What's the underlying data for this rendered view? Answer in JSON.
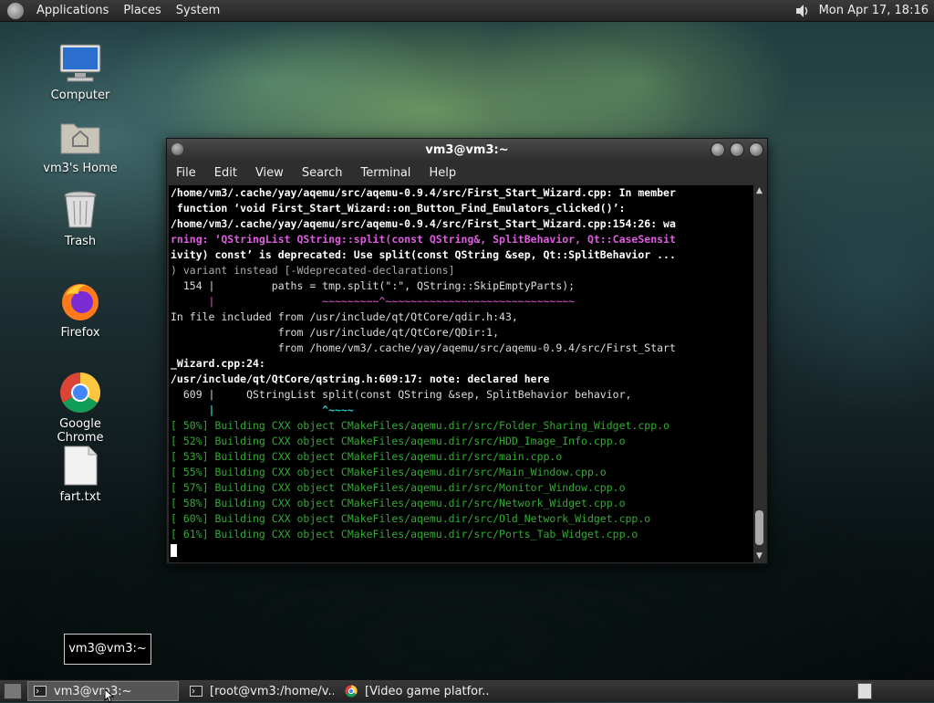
{
  "top_panel": {
    "menus": [
      "Applications",
      "Places",
      "System"
    ],
    "clock": "Mon Apr 17, 18:16"
  },
  "desktop_icons": [
    {
      "label": "Computer",
      "icon": "computer-icon"
    },
    {
      "label": "vm3's Home",
      "icon": "home-folder-icon"
    },
    {
      "label": "Trash",
      "icon": "trash-icon"
    },
    {
      "label": "Firefox",
      "icon": "firefox-icon"
    },
    {
      "label": "Google Chrome",
      "icon": "chrome-icon"
    },
    {
      "label": "fart.txt",
      "icon": "text-file-icon"
    }
  ],
  "terminal": {
    "title": "vm3@vm3:~",
    "menu": [
      "File",
      "Edit",
      "View",
      "Search",
      "Terminal",
      "Help"
    ],
    "lines": [
      "/home/vm3/.cache/yay/aqemu/src/aqemu-0.9.4/src/First_Start_Wizard.cpp: In member",
      " function ‘void First_Start_Wizard::on_Button_Find_Emulators_clicked()’:",
      "/home/vm3/.cache/yay/aqemu/src/aqemu-0.9.4/src/First_Start_Wizard.cpp:154:26: wa",
      "rning: ‘QStringList QString::split(const QString&, SplitBehavior, Qt::CaseSensit",
      "ivity) const’ is deprecated: Use split(const QString &sep, Qt::SplitBehavior ...",
      ") variant instead [-Wdeprecated-declarations]",
      "  154 |         paths = tmp.split(\":\", QString::SkipEmptyParts);",
      "      |                 ~~~~~~~~~^~~~~~~~~~~~~~~~~~~~~~~~~~~~~~~",
      "In file included from /usr/include/qt/QtCore/qdir.h:43,",
      "                 from /usr/include/qt/QtCore/QDir:1,",
      "                 from /home/vm3/.cache/yay/aqemu/src/aqemu-0.9.4/src/First_Start",
      "_Wizard.cpp:24:",
      "/usr/include/qt/QtCore/qstring.h:609:17: note: declared here",
      "  609 |     QStringList split(const QString &sep, SplitBehavior behavior,",
      "      |                 ^~~~~",
      "[ 50%] Building CXX object CMakeFiles/aqemu.dir/src/Folder_Sharing_Widget.cpp.o",
      "[ 52%] Building CXX object CMakeFiles/aqemu.dir/src/HDD_Image_Info.cpp.o",
      "[ 53%] Building CXX object CMakeFiles/aqemu.dir/src/main.cpp.o",
      "[ 55%] Building CXX object CMakeFiles/aqemu.dir/src/Main_Window.cpp.o",
      "[ 57%] Building CXX object CMakeFiles/aqemu.dir/src/Monitor_Window.cpp.o",
      "[ 58%] Building CXX object CMakeFiles/aqemu.dir/src/Network_Widget.cpp.o",
      "[ 60%] Building CXX object CMakeFiles/aqemu.dir/src/Old_Network_Widget.cpp.o",
      "[ 61%] Building CXX object CMakeFiles/aqemu.dir/src/Ports_Tab_Widget.cpp.o"
    ]
  },
  "tooltip": "vm3@vm3:~",
  "taskbar": [
    {
      "label": "vm3@vm3:~",
      "icon": "terminal-icon",
      "active": true
    },
    {
      "label": "[root@vm3:/home/v...",
      "icon": "terminal-icon",
      "active": false
    },
    {
      "label": "[Video game platfor...",
      "icon": "chrome-icon",
      "active": false
    }
  ],
  "colors": {
    "accent_green": "#33aa33",
    "magenta": "#e05ce0",
    "cyan": "#22cccc"
  }
}
